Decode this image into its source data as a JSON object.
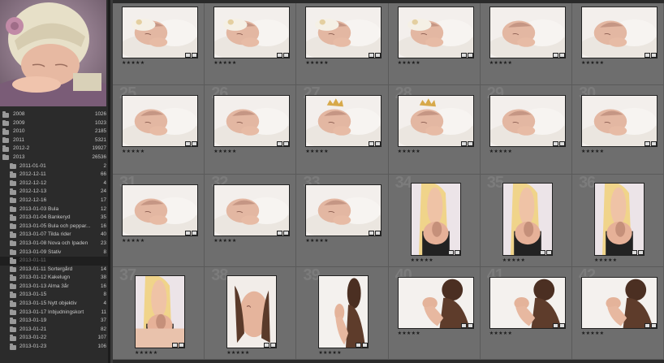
{
  "navigator": {
    "preview": "newborn-in-knit-hat"
  },
  "folders": [
    {
      "name": "2008",
      "count": "1026",
      "level": 0
    },
    {
      "name": "2009",
      "count": "1023",
      "level": 0
    },
    {
      "name": "2010",
      "count": "2185",
      "level": 0
    },
    {
      "name": "2011",
      "count": "5321",
      "level": 0
    },
    {
      "name": "2012-2",
      "count": "19927",
      "level": 0
    },
    {
      "name": "2013",
      "count": "26536",
      "level": 0
    },
    {
      "name": "2011-01-01",
      "count": "2",
      "level": 1
    },
    {
      "name": "2012-12-11",
      "count": "66",
      "level": 1
    },
    {
      "name": "2012-12-12",
      "count": "4",
      "level": 1
    },
    {
      "name": "2012-12-13",
      "count": "24",
      "level": 1
    },
    {
      "name": "2012-12-16",
      "count": "17",
      "level": 1
    },
    {
      "name": "2013-01-03 Bula",
      "count": "12",
      "level": 1
    },
    {
      "name": "2013-01-04 Bankeryd",
      "count": "35",
      "level": 1
    },
    {
      "name": "2013-01-05 Bula och peppar...",
      "count": "16",
      "level": 1
    },
    {
      "name": "2013-01-07 Tilda rider",
      "count": "40",
      "level": 1
    },
    {
      "name": "2013-01-08 Nova och Ipaden",
      "count": "23",
      "level": 1
    },
    {
      "name": "2013-01-09 Stativ",
      "count": "8",
      "level": 1
    },
    {
      "name": "2013-01-11",
      "count": "",
      "level": 1,
      "selected": true
    },
    {
      "name": "2013-01-11 Sortergård",
      "count": "14",
      "level": 1
    },
    {
      "name": "2013-01-12 Kakelugn",
      "count": "38",
      "level": 1
    },
    {
      "name": "2013-01-13 Alma 3år",
      "count": "16",
      "level": 1
    },
    {
      "name": "2013-01-15",
      "count": "8",
      "level": 1
    },
    {
      "name": "2013-01-15 Nytt objektiv",
      "count": "4",
      "level": 1
    },
    {
      "name": "2013-01-17 Inbjudningskort",
      "count": "11",
      "level": 1
    },
    {
      "name": "2013-01-19",
      "count": "37",
      "level": 1
    },
    {
      "name": "2013-01-21",
      "count": "82",
      "level": 1
    },
    {
      "name": "2013-01-22",
      "count": "107",
      "level": 1
    },
    {
      "name": "2013-01-23",
      "count": "106",
      "level": 1
    }
  ],
  "grid": {
    "stars": "★★★★★",
    "cells": [
      {
        "num": "",
        "kind": "baby-hat",
        "orient": "land"
      },
      {
        "num": "",
        "kind": "baby-hat",
        "orient": "land"
      },
      {
        "num": "",
        "kind": "baby-hat",
        "orient": "land"
      },
      {
        "num": "",
        "kind": "baby-hat",
        "orient": "land"
      },
      {
        "num": "",
        "kind": "baby",
        "orient": "land"
      },
      {
        "num": "",
        "kind": "baby",
        "orient": "land"
      },
      {
        "num": "25",
        "kind": "baby",
        "orient": "land"
      },
      {
        "num": "26",
        "kind": "baby",
        "orient": "land"
      },
      {
        "num": "27",
        "kind": "baby-crown",
        "orient": "land"
      },
      {
        "num": "28",
        "kind": "baby-crown",
        "orient": "land"
      },
      {
        "num": "29",
        "kind": "baby",
        "orient": "land"
      },
      {
        "num": "30",
        "kind": "baby",
        "orient": "land"
      },
      {
        "num": "31",
        "kind": "baby",
        "orient": "land"
      },
      {
        "num": "32",
        "kind": "baby",
        "orient": "land"
      },
      {
        "num": "33",
        "kind": "baby",
        "orient": "land"
      },
      {
        "num": "34",
        "kind": "mother",
        "orient": "port"
      },
      {
        "num": "35",
        "kind": "mother",
        "orient": "port"
      },
      {
        "num": "36",
        "kind": "mother",
        "orient": "port"
      },
      {
        "num": "37",
        "kind": "mother-close",
        "orient": "port"
      },
      {
        "num": "38",
        "kind": "hands",
        "orient": "port"
      },
      {
        "num": "39",
        "kind": "father",
        "orient": "port"
      },
      {
        "num": "40",
        "kind": "father",
        "orient": "land"
      },
      {
        "num": "41",
        "kind": "father",
        "orient": "land"
      },
      {
        "num": "42",
        "kind": "father",
        "orient": "land"
      }
    ]
  }
}
